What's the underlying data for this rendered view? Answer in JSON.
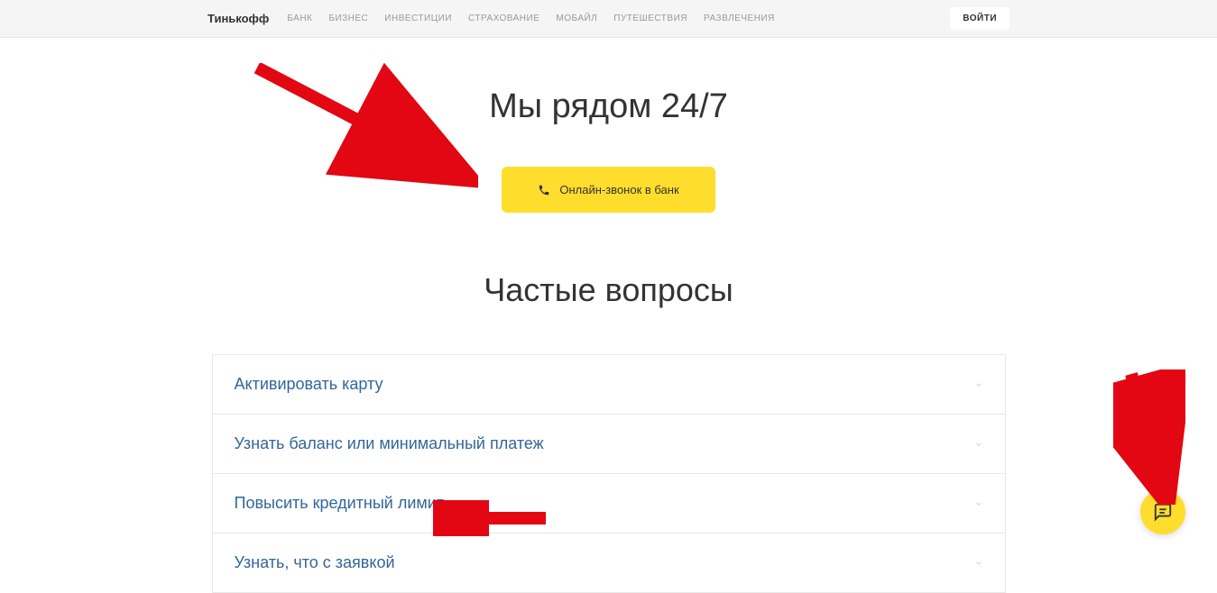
{
  "header": {
    "logo": "Тинькофф",
    "nav": [
      "БАНК",
      "БИЗНЕС",
      "ИНВЕСТИЦИИ",
      "СТРАХОВАНИЕ",
      "МОБАЙЛ",
      "ПУТЕШЕСТВИЯ",
      "РАЗВЛЕЧЕНИЯ"
    ],
    "login": "ВОЙТИ"
  },
  "hero": {
    "title": "Мы рядом 24/7",
    "call_button": "Онлайн-звонок в банк"
  },
  "faq": {
    "title": "Частые вопросы",
    "items": [
      "Активировать карту",
      "Узнать баланс или минимальный платеж",
      "Повысить кредитный лимит",
      "Узнать, что с заявкой"
    ]
  }
}
